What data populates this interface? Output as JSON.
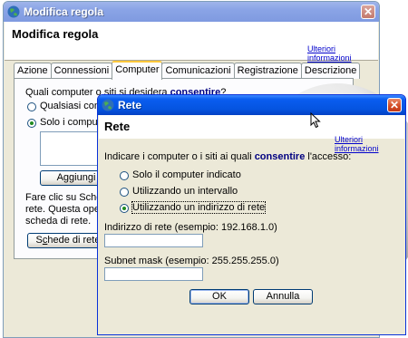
{
  "back_dialog": {
    "title": "Modifica regola",
    "heading": "Modifica regola",
    "more_info": "Ulteriori informazioni",
    "tabs": [
      {
        "label": "Azione"
      },
      {
        "label": "Connessioni"
      },
      {
        "label": "Computer",
        "active": true
      },
      {
        "label": "Comunicazioni"
      },
      {
        "label": "Registrazione"
      },
      {
        "label": "Descrizione"
      }
    ],
    "question_prefix": "Quali computer o siti si desidera ",
    "question_bold": "consentire",
    "question_suffix": "?",
    "radio_any": "Qualsiasi com",
    "radio_only": "Solo i compute",
    "add_button": "Aggiungi",
    "hint_lines": [
      "Fare clic su Sche",
      "rete. Questa opera",
      "scheda di rete."
    ],
    "nic_button_prefix": "S",
    "nic_button_u": "c",
    "nic_button_suffix": "hede di rete"
  },
  "front_dialog": {
    "title": "Rete",
    "heading": "Rete",
    "more_info": "Ulteriori informazioni",
    "prompt_prefix": "Indicare i computer o i siti ai quali ",
    "prompt_bold": "consentire",
    "prompt_suffix": " l'accesso:",
    "options": [
      {
        "label": "Solo il computer indicato",
        "selected": false
      },
      {
        "label": "Utilizzando un intervallo",
        "selected": false
      },
      {
        "label": "Utilizzando un indirizzo di rete",
        "selected": true
      }
    ],
    "network_label": "Indirizzo di rete (esempio: 192.168.1.0)",
    "network_value": "",
    "subnet_label": "Subnet mask (esempio: 255.255.255.0)",
    "subnet_value": "",
    "ok_label": "OK",
    "cancel_label": "Annulla"
  },
  "colors": {
    "titlebar_active": "#0554e0",
    "titlebar_inactive": "#8aa4e6",
    "link": "#0000cc",
    "dialog_bg": "#ece9d8"
  }
}
